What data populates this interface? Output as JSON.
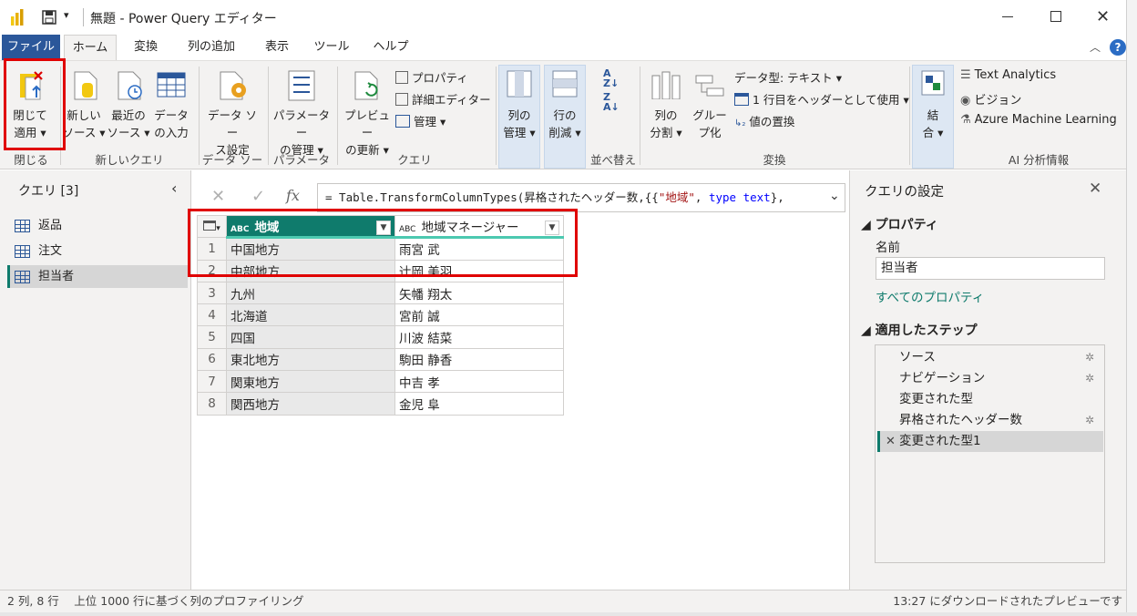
{
  "window": {
    "title": "無題 - Power Query エディター"
  },
  "menu": {
    "tabs": [
      "ファイル",
      "ホーム",
      "変換",
      "列の追加",
      "表示",
      "ツール",
      "ヘルプ"
    ]
  },
  "ribbon": {
    "close_apply": [
      "閉じて",
      "適用 ▾"
    ],
    "new_source": [
      "新しい",
      "ソース ▾"
    ],
    "recent_sources": [
      "最近の",
      "ソース ▾"
    ],
    "enter_data": [
      "データ",
      "の入力"
    ],
    "data_source_settings": [
      "データ ソー",
      "ス設定"
    ],
    "manage_parameters": [
      "パラメーター",
      "の管理 ▾"
    ],
    "refresh_preview": [
      "プレビュー",
      "の更新 ▾"
    ],
    "properties": "プロパティ",
    "advanced_editor": "詳細エディター",
    "manage": "管理 ▾",
    "manage_columns": [
      "列の",
      "管理 ▾"
    ],
    "reduce_rows": [
      "行の",
      "削減 ▾"
    ],
    "split_column": [
      "列の",
      "分割 ▾"
    ],
    "group_by": [
      "グルー",
      "プ化"
    ],
    "data_type": "データ型: テキスト ▾",
    "use_first_row": "1 行目をヘッダーとして使用 ▾",
    "replace_values": "値の置換",
    "combine": [
      "結",
      "合 ▾"
    ],
    "text_analytics": "Text Analytics",
    "vision": "ビジョン",
    "azure_ml": "Azure Machine Learning",
    "groups": [
      "閉じる",
      "新しいクエリ",
      "データ ソース",
      "パラメーター",
      "クエリ",
      "並べ替え",
      "変換",
      "AI 分析情報"
    ]
  },
  "queries": {
    "header": "クエリ [3]",
    "items": [
      "返品",
      "注文",
      "担当者"
    ],
    "selected": "担当者"
  },
  "formula": {
    "fx": "fx",
    "text_prefix": "= Table.TransformColumnTypes(昇格されたヘッダー数,{{",
    "text_string": "\"地域\"",
    "text_mid": ", ",
    "text_keyword": "type text",
    "text_suffix": "},"
  },
  "grid": {
    "type_icon": "ABC",
    "columns": [
      "地域",
      "地域マネージャー"
    ],
    "rows": [
      [
        "1",
        "中国地方",
        "雨宮 武"
      ],
      [
        "2",
        "中部地方",
        "辻岡 美羽"
      ],
      [
        "3",
        "九州",
        "矢幡 翔太"
      ],
      [
        "4",
        "北海道",
        "宮前 誠"
      ],
      [
        "5",
        "四国",
        "川波 結菜"
      ],
      [
        "6",
        "東北地方",
        "駒田 静香"
      ],
      [
        "7",
        "関東地方",
        "中吉 孝"
      ],
      [
        "8",
        "関西地方",
        "金児 阜"
      ]
    ]
  },
  "settings": {
    "title": "クエリの設定",
    "properties_header": "◢ プロパティ",
    "name_label": "名前",
    "name_value": "担当者",
    "all_properties": "すべてのプロパティ",
    "steps_header": "◢ 適用したステップ",
    "steps": [
      "ソース",
      "ナビゲーション",
      "変更された型",
      "昇格されたヘッダー数",
      "変更された型1"
    ]
  },
  "status": {
    "left": "2 列, 8 行　 上位 1000 行に基づく列のプロファイリング",
    "right": "13:27 にダウンロードされたプレビューです"
  },
  "colors": {
    "accent": "#0f7b6c",
    "file_tab": "#2b579a",
    "highlight_red": "#e00000"
  }
}
